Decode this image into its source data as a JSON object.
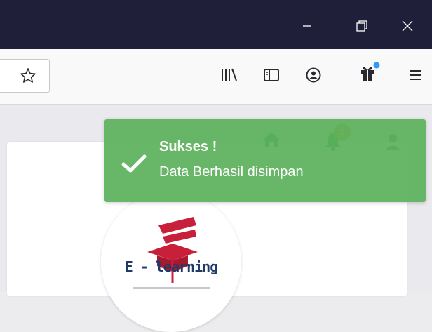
{
  "toast": {
    "title": "Sukses !",
    "message": "Data Berhasil disimpan",
    "color": "#5cb25c"
  },
  "nav": {
    "notification_count": "1"
  },
  "logo": {
    "text": "E - learning"
  },
  "icons": {
    "window": [
      "minimize-icon",
      "restore-icon",
      "close-icon"
    ],
    "toolbar": [
      "star-icon",
      "library-icon",
      "sidebar-icon",
      "account-icon",
      "gift-icon",
      "menu-icon"
    ],
    "nav": [
      "home-icon",
      "bell-icon",
      "user-remove-icon"
    ],
    "toast": "check-icon"
  },
  "colors": {
    "titlebar": "#1f1f3a",
    "toolbar": "#f9f9fa",
    "badge": "#c49a2c",
    "logo_red": "#c8203a",
    "logo_blue": "#1e3a6a"
  }
}
